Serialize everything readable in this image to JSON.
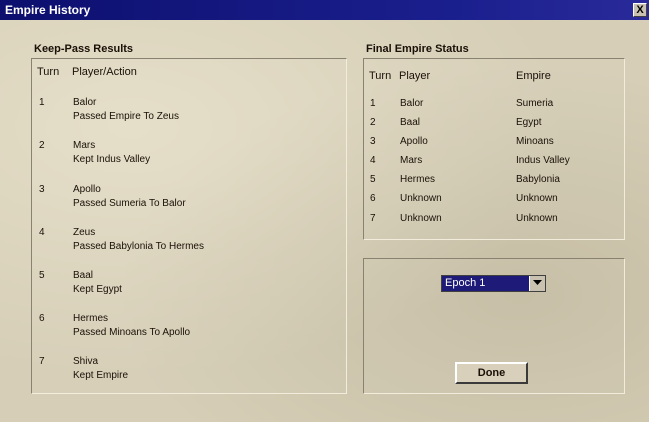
{
  "window": {
    "title": "Empire History",
    "close_glyph": "X"
  },
  "keep_pass": {
    "title": "Keep-Pass Results",
    "headers": {
      "turn": "Turn",
      "player_action": "Player/Action"
    },
    "rows": [
      {
        "turn": "1",
        "player": "Balor",
        "action": "Passed Empire To Zeus"
      },
      {
        "turn": "2",
        "player": "Mars",
        "action": "Kept Indus Valley"
      },
      {
        "turn": "3",
        "player": "Apollo",
        "action": "Passed Sumeria To Balor"
      },
      {
        "turn": "4",
        "player": "Zeus",
        "action": "Passed Babylonia To Hermes"
      },
      {
        "turn": "5",
        "player": "Baal",
        "action": "Kept Egypt"
      },
      {
        "turn": "6",
        "player": "Hermes",
        "action": "Passed Minoans To Apollo"
      },
      {
        "turn": "7",
        "player": "Shiva",
        "action": "Kept Empire"
      }
    ]
  },
  "final_status": {
    "title": "Final Empire Status",
    "headers": {
      "turn": "Turn",
      "player": "Player",
      "empire": "Empire"
    },
    "rows": [
      {
        "turn": "1",
        "player": "Balor",
        "empire": "Sumeria"
      },
      {
        "turn": "2",
        "player": "Baal",
        "empire": "Egypt"
      },
      {
        "turn": "3",
        "player": "Apollo",
        "empire": "Minoans"
      },
      {
        "turn": "4",
        "player": "Mars",
        "empire": "Indus Valley"
      },
      {
        "turn": "5",
        "player": "Hermes",
        "empire": "Babylonia"
      },
      {
        "turn": "6",
        "player": "Unknown",
        "empire": "Unknown"
      },
      {
        "turn": "7",
        "player": "Unknown",
        "empire": "Unknown"
      }
    ]
  },
  "controls": {
    "epoch_select": {
      "selected": "Epoch 1"
    },
    "done_label": "Done"
  },
  "colors": {
    "title_bar": "#0d0f6e",
    "background": "#d6ceb6",
    "select_bg": "#1e1a78"
  }
}
